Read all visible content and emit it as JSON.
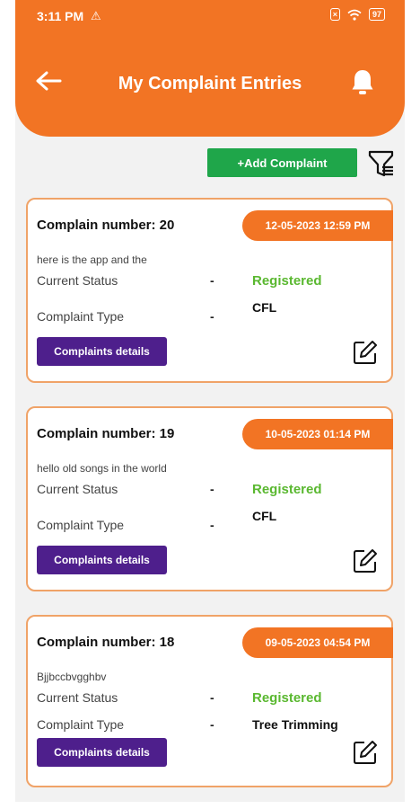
{
  "status_bar": {
    "time": "3:11 PM",
    "battery": "97"
  },
  "header": {
    "title": "My Complaint Entries"
  },
  "toolbar": {
    "add_label": "+Add Complaint"
  },
  "complaints": [
    {
      "number_label": "Complain number: 20",
      "date": "12-05-2023 12:59 PM",
      "description": "here is the app and the",
      "status_label": "Current Status",
      "status_dash": "-",
      "status_value": "Registered",
      "type_label": "Complaint Type",
      "type_dash": "-",
      "type_value": "CFL",
      "details_label": "Complaints details"
    },
    {
      "number_label": "Complain number: 19",
      "date": "10-05-2023 01:14 PM",
      "description": "hello old songs in the world",
      "status_label": "Current Status",
      "status_dash": "-",
      "status_value": "Registered",
      "type_label": "Complaint Type",
      "type_dash": "-",
      "type_value": "CFL",
      "details_label": "Complaints details"
    },
    {
      "number_label": "Complain number: 18",
      "date": "09-05-2023 04:54 PM",
      "description": "Bjjbccbvgghbv",
      "status_label": "Current Status",
      "status_dash": "-",
      "status_value": "Registered",
      "type_label": "Complaint Type",
      "type_dash": "-",
      "type_value": "Tree Trimming",
      "details_label": "Complaints details"
    }
  ],
  "colors": {
    "header": "#f27424",
    "add_button": "#1fa64a",
    "details_button": "#4e1f8c",
    "status_registered": "#5ab830",
    "card_border": "#f0a368"
  },
  "icons": [
    "warning-icon",
    "sim-icon",
    "wifi-icon",
    "battery-icon",
    "back-arrow-icon",
    "bell-icon",
    "filter-list-icon",
    "edit-icon"
  ]
}
